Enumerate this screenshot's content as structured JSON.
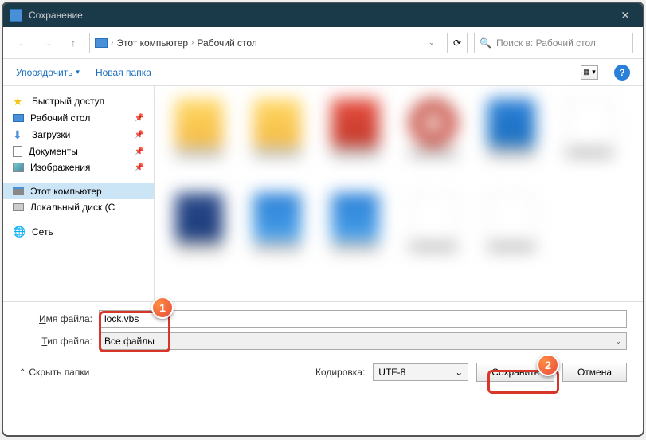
{
  "window": {
    "title": "Сохранение"
  },
  "nav": {
    "breadcrumb": [
      "Этот компьютер",
      "Рабочий стол"
    ],
    "search_placeholder": "Поиск в: Рабочий стол"
  },
  "toolbar": {
    "organize": "Упорядочить",
    "new_folder": "Новая папка"
  },
  "sidebar": {
    "quick_access": "Быстрый доступ",
    "desktop": "Рабочий стол",
    "downloads": "Загрузки",
    "documents": "Документы",
    "pictures": "Изображения",
    "this_pc": "Этот компьютер",
    "local_disk": "Локальный диск (С",
    "network": "Сеть"
  },
  "fields": {
    "filename_label": "Имя файла",
    "filename_value": "lock.vbs",
    "filetype_label": "Тип файла",
    "filetype_value": "Все файлы"
  },
  "footer": {
    "hide_folders": "Скрыть папки",
    "encoding_label": "Кодировка:",
    "encoding_value": "UTF-8",
    "save": "Сохранить",
    "cancel": "Отмена"
  },
  "badges": {
    "one": "1",
    "two": "2"
  }
}
